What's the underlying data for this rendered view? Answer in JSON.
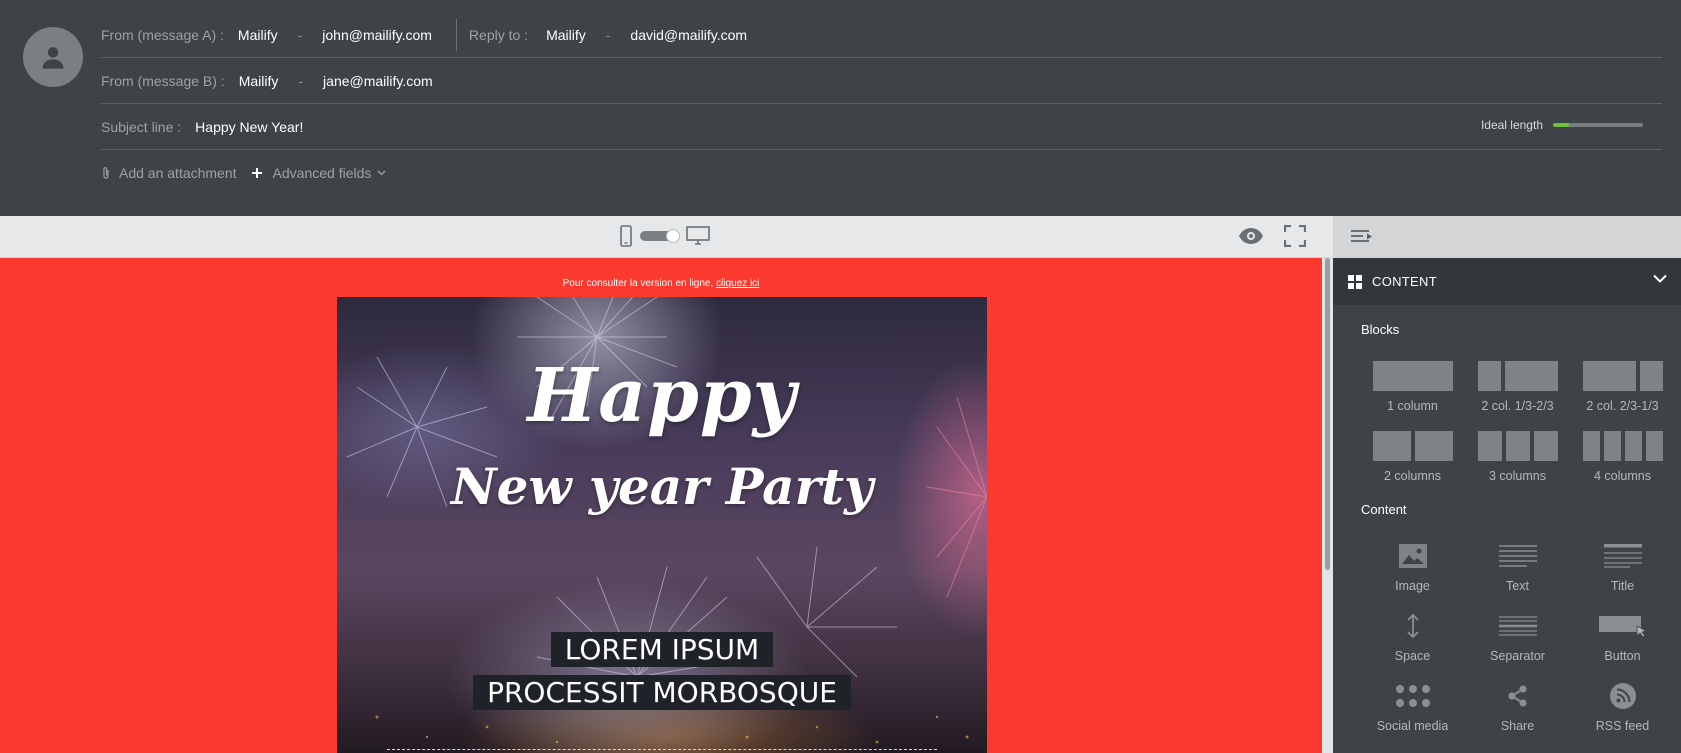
{
  "header": {
    "from_a": {
      "label": "From (message A) :",
      "name": "Mailify",
      "separator": "-",
      "email": "john@mailify.com"
    },
    "reply_to": {
      "label": "Reply to :",
      "name": "Mailify",
      "separator": "-",
      "email": "david@mailify.com"
    },
    "from_b": {
      "label": "From (message B) :",
      "name": "Mailify",
      "separator": "-",
      "email": "jane@mailify.com"
    },
    "subject": {
      "label": "Subject line :",
      "value": "Happy New Year!",
      "ideal_label": "Ideal length",
      "ideal_fraction": 0.18
    },
    "attachment_label": "Add an attachment",
    "advanced_label": "Advanced fields"
  },
  "toolbar": {
    "icons": [
      "mobile-icon",
      "desktop-icon",
      "eye-icon",
      "fullscreen-icon",
      "panel-toggle-icon"
    ]
  },
  "canvas": {
    "online_note": "Pour consulter la version en ligne,",
    "online_link": "cliquez ici",
    "hero_line1": "Happy",
    "hero_line2": "New year Party",
    "tag1": "LOREM IPSUM",
    "tag2": "PROCESSIT MORBOSQUE",
    "background_color": "#fb392e"
  },
  "panel": {
    "title": "CONTENT",
    "blocks_heading": "Blocks",
    "blocks": [
      {
        "label": "1 column"
      },
      {
        "label": "2 col. 1/3-2/3"
      },
      {
        "label": "2 col. 2/3-1/3"
      },
      {
        "label": "2 columns"
      },
      {
        "label": "3 columns"
      },
      {
        "label": "4 columns"
      }
    ],
    "content_heading": "Content",
    "content": [
      {
        "label": "Image",
        "icon": "image-icon"
      },
      {
        "label": "Text",
        "icon": "text-icon"
      },
      {
        "label": "Title",
        "icon": "title-icon"
      },
      {
        "label": "Space",
        "icon": "space-icon"
      },
      {
        "label": "Separator",
        "icon": "separator-icon"
      },
      {
        "label": "Button",
        "icon": "button-icon"
      },
      {
        "label": "Social media",
        "icon": "social-media-icon"
      },
      {
        "label": "Share",
        "icon": "share-icon"
      },
      {
        "label": "RSS feed",
        "icon": "rss-feed-icon"
      }
    ]
  },
  "colors": {
    "header_bg": "#3d4347",
    "accent_green": "#6fc23a",
    "canvas_red": "#fb392e"
  }
}
